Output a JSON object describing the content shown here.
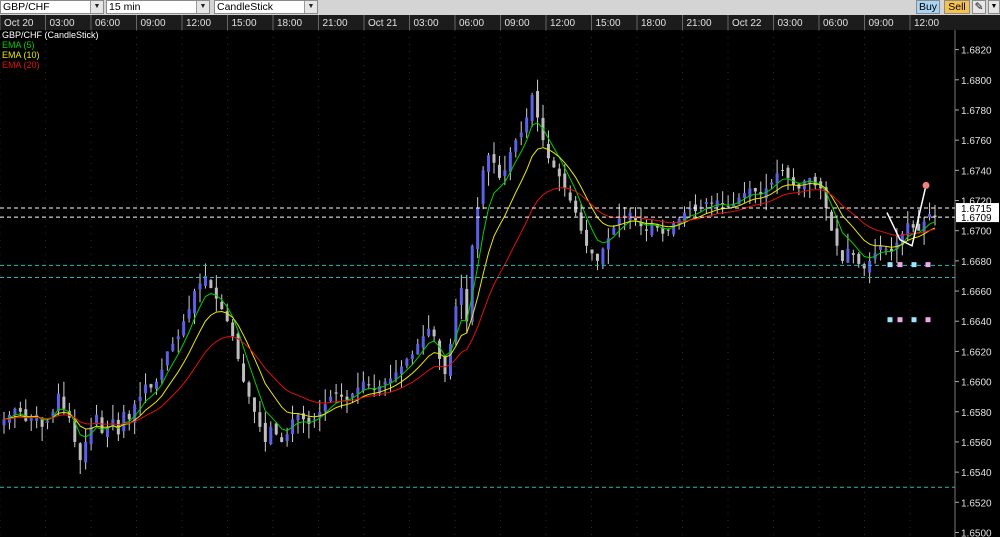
{
  "toolbar": {
    "symbol": "GBP/CHF",
    "timeframe": "15 min",
    "chart_type": "CandleStick",
    "buy_label": "Buy",
    "sell_label": "Sell",
    "tool_icon": "pencil-icon"
  },
  "legend": {
    "title": "GBP/CHF (CandleStick)",
    "ema5": "EMA (5)",
    "ema10": "EMA (10)",
    "ema20": "EMA (20)"
  },
  "colors": {
    "ema5": "#00d000",
    "ema10": "#e8e800",
    "ema20": "#e01010",
    "bull": "#5b61e6",
    "bear": "#bdbdbd",
    "hline": "#2bb7c0",
    "grid": "#5a5a5a",
    "background": "#000000"
  },
  "time_axis": [
    "Oct 20",
    "03:00",
    "06:00",
    "09:00",
    "12:00",
    "15:00",
    "18:00",
    "21:00",
    "Oct 21",
    "03:00",
    "06:00",
    "09:00",
    "12:00",
    "15:00",
    "18:00",
    "21:00",
    "Oct 22",
    "03:00",
    "06:00",
    "09:00",
    "12:00"
  ],
  "price_axis": [
    "1.6820",
    "1.6800",
    "1.6780",
    "1.6760",
    "1.6740",
    "1.6720",
    "1.6700",
    "1.6680",
    "1.6660",
    "1.6640",
    "1.6620",
    "1.6600",
    "1.6580",
    "1.6560",
    "1.6540",
    "1.6520",
    "1.6500"
  ],
  "price_tags": [
    {
      "label": "1.6715",
      "value": 1.6715
    },
    {
      "label": "1.6709",
      "value": 1.6709
    }
  ],
  "chart_data": {
    "type": "candlestick",
    "title": "GBP/CHF (CandleStick)",
    "ylim": [
      1.6497,
      1.6833
    ],
    "x": [
      "Oct 20",
      "03:00",
      "06:00",
      "09:00",
      "12:00",
      "15:00",
      "18:00",
      "21:00",
      "Oct 21",
      "03:00",
      "06:00",
      "09:00",
      "12:00",
      "15:00",
      "18:00",
      "21:00",
      "Oct 22",
      "03:00",
      "06:00",
      "09:00",
      "12:00"
    ],
    "close": [
      1.6575,
      1.6578,
      1.6582,
      1.658,
      1.6574,
      1.6576,
      1.6578,
      1.657,
      1.6574,
      1.658,
      1.6592,
      1.6582,
      1.6576,
      1.656,
      1.6548,
      1.656,
      1.657,
      1.6578,
      1.6566,
      1.657,
      1.6575,
      1.6565,
      1.658,
      1.6575,
      1.6585,
      1.659,
      1.6598,
      1.6596,
      1.66,
      1.6608,
      1.662,
      1.6625,
      1.663,
      1.664,
      1.6648,
      1.666,
      1.6665,
      1.667,
      1.6662,
      1.6655,
      1.6648,
      1.664,
      1.663,
      1.6615,
      1.66,
      1.659,
      1.658,
      1.657,
      1.656,
      1.657,
      1.6565,
      1.656,
      1.6565,
      1.6575,
      1.6578,
      1.6575,
      1.6572,
      1.6575,
      1.658,
      1.6585,
      1.659,
      1.6592,
      1.659,
      1.6588,
      1.6592,
      1.6596,
      1.66,
      1.6598,
      1.6595,
      1.6597,
      1.66,
      1.6602,
      1.6606,
      1.661,
      1.6615,
      1.6618,
      1.6625,
      1.663,
      1.6635,
      1.663,
      1.6615,
      1.6605,
      1.6625,
      1.665,
      1.6662,
      1.664,
      1.669,
      1.6715,
      1.674,
      1.675,
      1.6745,
      1.6735,
      1.674,
      1.6752,
      1.676,
      1.6765,
      1.6775,
      1.679,
      1.6775,
      1.676,
      1.6748,
      1.6742,
      1.6736,
      1.6728,
      1.672,
      1.6712,
      1.67,
      1.669,
      1.6685,
      1.668,
      1.6688,
      1.6695,
      1.6702,
      1.6708,
      1.671,
      1.6712,
      1.6707,
      1.6703,
      1.67,
      1.6705,
      1.6702,
      1.6698,
      1.67,
      1.6705,
      1.6708,
      1.6712,
      1.6715,
      1.6713,
      1.6716,
      1.6719,
      1.6718,
      1.672,
      1.6718,
      1.6716,
      1.6718,
      1.6722,
      1.6725,
      1.6728,
      1.6726,
      1.6724,
      1.6728,
      1.6732,
      1.6738,
      1.674,
      1.6735,
      1.673,
      1.6728,
      1.6733,
      1.6735,
      1.673,
      1.6728,
      1.6715,
      1.67,
      1.669,
      1.668,
      1.6688,
      1.6684,
      1.6678,
      1.6675,
      1.668,
      1.6685,
      1.669,
      1.6688,
      1.6686,
      1.6692,
      1.6698,
      1.6705,
      1.6702,
      1.67,
      1.6706,
      1.6711,
      1.6709
    ],
    "hlines": [
      1.6677,
      1.6669,
      1.653
    ],
    "series": [
      {
        "name": "EMA (5)",
        "period": 5
      },
      {
        "name": "EMA (10)",
        "period": 10
      },
      {
        "name": "EMA (20)",
        "period": 20
      }
    ],
    "grid": true
  }
}
